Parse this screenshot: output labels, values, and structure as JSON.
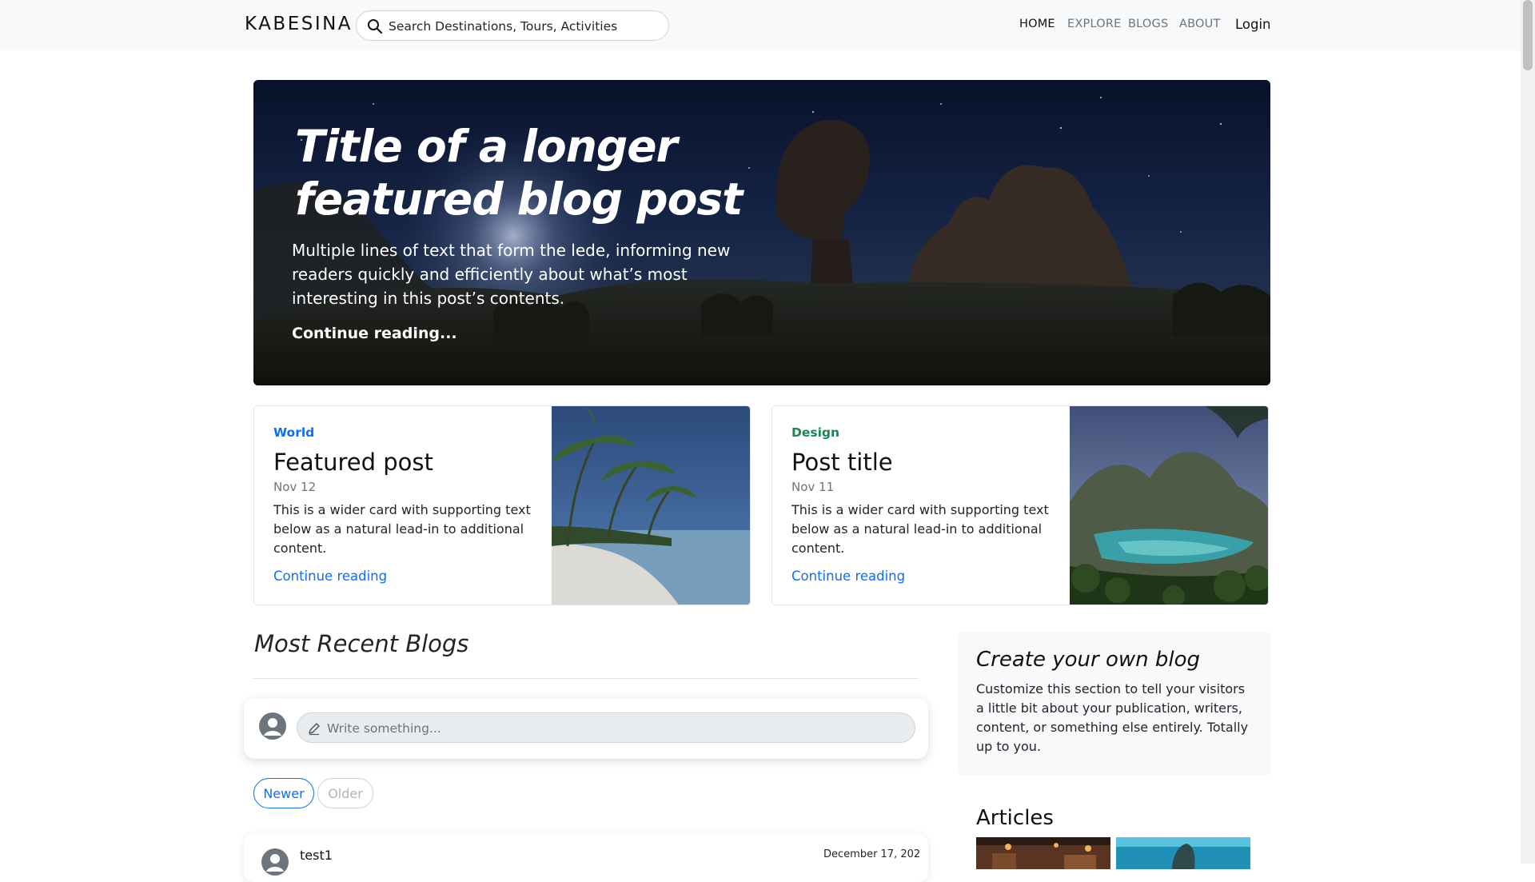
{
  "header": {
    "brand": "KABESINA",
    "search_placeholder": "Search Destinations, Tours, Activities",
    "nav": [
      {
        "label": "HOME",
        "active": true
      },
      {
        "label": "EXPLORE",
        "active": false
      },
      {
        "label": "BLOGS",
        "active": false
      },
      {
        "label": "ABOUT",
        "active": false
      }
    ],
    "login_label": "Login"
  },
  "hero": {
    "title": "Title of a longer featured blog post",
    "lede": "Multiple lines of text that form the lede, informing new readers quickly and efficiently about what’s most interesting in this post’s contents.",
    "link": "Continue reading..."
  },
  "cards": [
    {
      "category": "World",
      "category_color": "#0d6efd",
      "title": "Featured post",
      "date": "Nov 12",
      "text": "This is a wider card with supporting text below as a natural lead-in to additional content.",
      "link": "Continue reading"
    },
    {
      "category": "Design",
      "category_color": "#198754",
      "title": "Post title",
      "date": "Nov 11",
      "text": "This is a wider card with supporting text below as a natural lead-in to additional content.",
      "link": "Continue reading"
    }
  ],
  "recent": {
    "heading": "Most Recent Blogs",
    "composer_placeholder": "Write something...",
    "newer_label": "Newer",
    "older_label": "Older",
    "posts": [
      {
        "author": "test1",
        "date": "December 17, 202"
      }
    ]
  },
  "sidebar": {
    "about_heading": "Create your own blog",
    "about_text": "Customize this section to tell your visitors a little bit about your publication, writers, content, or something else entirely. Totally up to you.",
    "articles_heading": "Articles"
  },
  "icons": {
    "search": "search-icon",
    "user": "user-avatar-icon",
    "pencil": "pencil-icon"
  },
  "colors": {
    "accent": "#0d6efd",
    "design_tag": "#198754"
  }
}
